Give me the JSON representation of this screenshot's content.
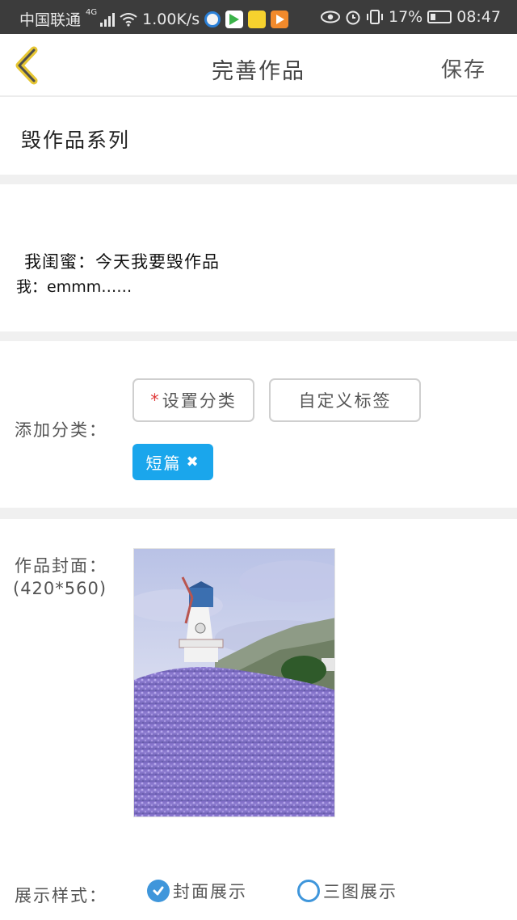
{
  "status_bar": {
    "carrier": "中国联通",
    "network": "4G",
    "speed": "1.00K/s",
    "battery": "17%",
    "time": "08:47",
    "icons": [
      "signal-icon",
      "wifi-icon",
      "app-icon",
      "eye-icon",
      "alarm-icon",
      "vibrate-icon",
      "battery-icon"
    ]
  },
  "header": {
    "title": "完善作品",
    "save_label": "保存",
    "back_icon": "chevron-left-icon",
    "accent_color": "#e6c632"
  },
  "series": {
    "name": "毁作品系列"
  },
  "description": {
    "line1": "我闺蜜：今天我要毁作品",
    "line2": "我：emmm……"
  },
  "category": {
    "label": "添加分类：",
    "required_mark": "*",
    "set_category_label": "设置分类",
    "custom_tag_label": "自定义标签",
    "selected_tag": "短篇",
    "tag_color": "#1aa6ec"
  },
  "cover": {
    "label": "作品封面：",
    "size_hint": "(420*560)"
  },
  "display_style": {
    "label": "展示样式：",
    "options": [
      {
        "label": "封面展示",
        "selected": true
      },
      {
        "label": "三图展示",
        "selected": false
      }
    ],
    "radio_color": "#3f96db"
  }
}
